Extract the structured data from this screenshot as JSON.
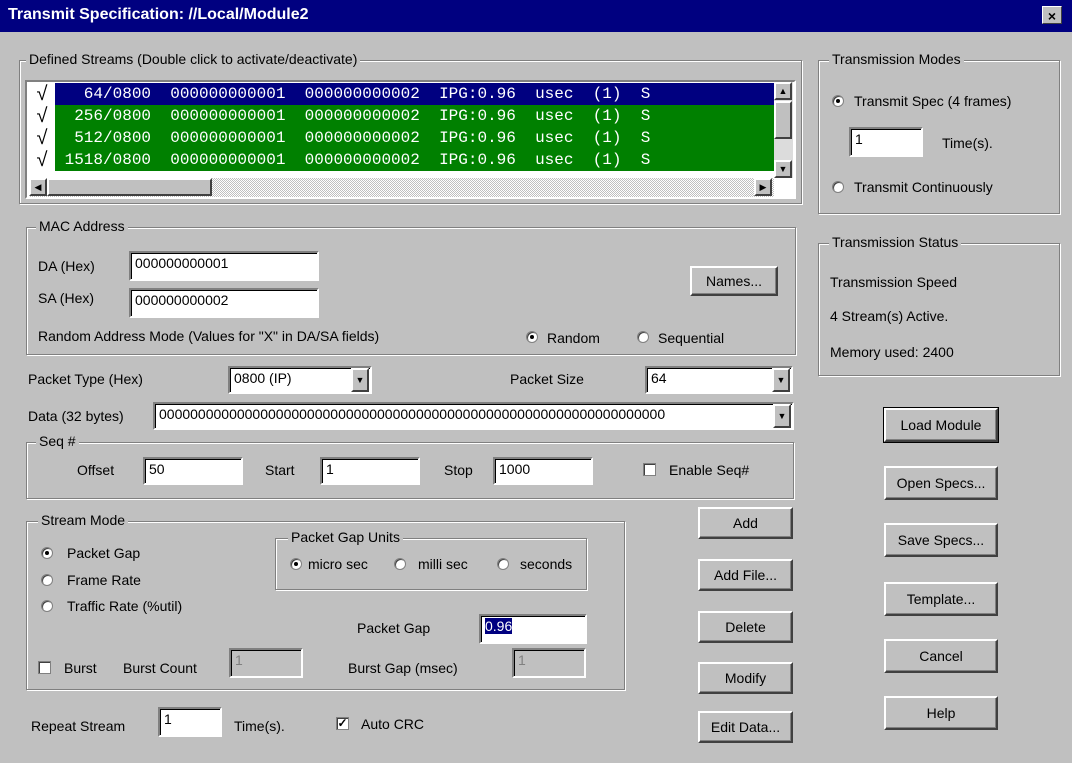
{
  "window": {
    "title": "Transmit Specification: //Local/Module2",
    "close_glyph": "×"
  },
  "streams": {
    "legend": "Defined Streams (Double click to activate/deactivate)",
    "rows": [
      {
        "text": "   64/0800  000000000001  000000000002  IPG:0.96  usec  (1)  S",
        "color": "#000080",
        "checked": true,
        "selected": true
      },
      {
        "text": "  256/0800  000000000001  000000000002  IPG:0.96  usec  (1)  S",
        "color": "#008000",
        "checked": true
      },
      {
        "text": "  512/0800  000000000001  000000000002  IPG:0.96  usec  (1)  S",
        "color": "#008000",
        "checked": true
      },
      {
        "text": " 1518/0800  000000000001  000000000002  IPG:0.96  usec  (1)  S",
        "color": "#008000",
        "checked": true
      }
    ],
    "check_glyph": "√"
  },
  "mac": {
    "legend": "MAC Address",
    "da_label": "DA (Hex)",
    "da_value": "000000000001",
    "sa_label": "SA (Hex)",
    "sa_value": "000000000002",
    "names_button": "Names...",
    "random_mode_label": "Random Address Mode (Values for \"X\" in DA/SA fields)",
    "random_label": "Random",
    "sequential_label": "Sequential"
  },
  "packet": {
    "type_label": "Packet Type (Hex)",
    "type_value": "0800 (IP)",
    "size_label": "Packet Size",
    "size_value": "64",
    "data_label": "Data (32 bytes)",
    "data_value": "00000000000000000000000000000000000000000000000000000000000000000"
  },
  "seq": {
    "legend": "Seq #",
    "offset_label": "Offset",
    "offset_value": "50",
    "start_label": "Start",
    "start_value": "1",
    "stop_label": "Stop",
    "stop_value": "1000",
    "enable_label": "Enable Seq#"
  },
  "stream_mode": {
    "legend": "Stream Mode",
    "packet_gap": "Packet Gap",
    "frame_rate": "Frame Rate",
    "traffic_rate": "Traffic Rate (%util)",
    "units_legend": "Packet Gap Units",
    "micro": "micro sec",
    "milli": "milli sec",
    "seconds": "seconds",
    "gap_label": "Packet Gap",
    "gap_value": "0.96",
    "burst_label": "Burst",
    "burst_count_label": "Burst Count",
    "burst_count_value": "1",
    "burst_gap_label": "Burst Gap (msec)",
    "burst_gap_value": "1"
  },
  "repeat": {
    "label": "Repeat Stream",
    "value": "1",
    "times_label": "Time(s).",
    "auto_crc": "Auto CRC"
  },
  "actions": {
    "add": "Add",
    "add_file": "Add File...",
    "delete": "Delete",
    "modify": "Modify",
    "edit_data": "Edit Data..."
  },
  "modes": {
    "legend": "Transmission Modes",
    "transmit_spec": "Transmit Spec (4 frames)",
    "times_value": "1",
    "times_label": "Time(s).",
    "continuous": "Transmit Continuously"
  },
  "status": {
    "legend": "Transmission Status",
    "speed": "Transmission Speed",
    "active": "4 Stream(s) Active.",
    "memory": "Memory used: 2400"
  },
  "side_buttons": {
    "load_module": "Load Module",
    "open_specs": "Open Specs...",
    "save_specs": "Save Specs...",
    "template": "Template...",
    "cancel": "Cancel",
    "help": "Help"
  },
  "glyphs": {
    "up": "▲",
    "down": "▼",
    "left": "◀",
    "right": "▶"
  }
}
